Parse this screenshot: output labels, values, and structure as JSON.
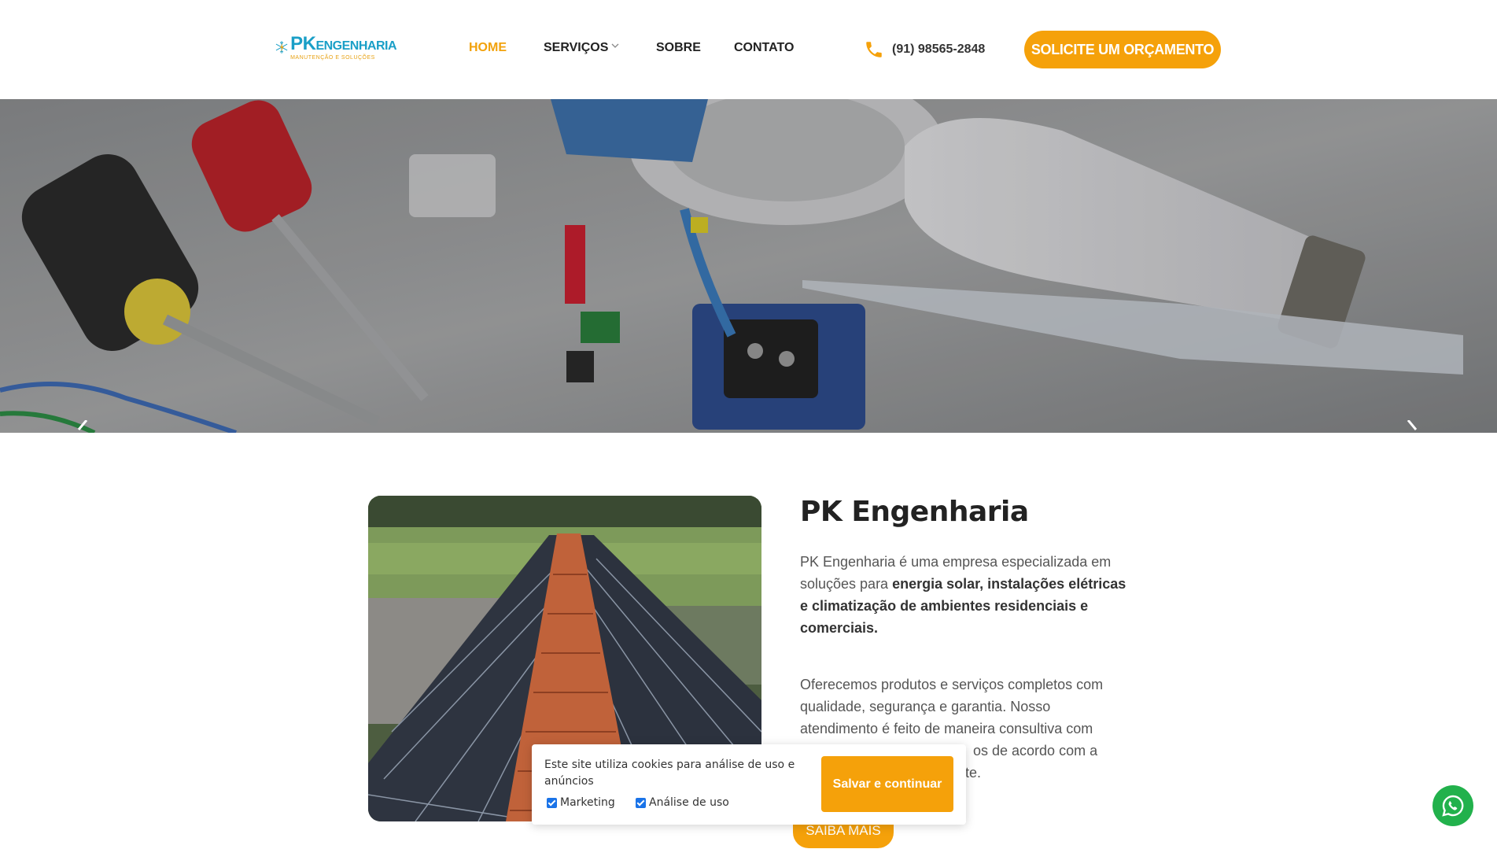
{
  "header": {
    "logo": {
      "title_big": "PK",
      "title_small": "ENGENHARIA",
      "subtitle": "MANUTENÇÃO E SOLUÇÕES"
    },
    "nav": [
      {
        "label": "HOME",
        "active": true
      },
      {
        "label": "SERVIÇOS",
        "has_dropdown": true
      },
      {
        "label": "SOBRE"
      },
      {
        "label": "CONTATO"
      }
    ],
    "phone": "(91) 98565-2848",
    "cta": "SOLICITE UM ORÇAMENTO"
  },
  "hero": {
    "prev_icon": "chevron-left-icon",
    "next_icon": "chevron-right-icon"
  },
  "about": {
    "title": "PK Engenharia",
    "p1_plain": "PK Engenharia é uma empresa especializada em soluções para ",
    "p1_bold": "energia solar, instalações elétricas e climatização de ambientes residenciais e comerciais.",
    "p2": "Oferecemos produtos e serviços completos com qualidade, segurança e garantia. Nosso atendimento é feito de maneira consultiva com",
    "p2_line5_visible": "os de acordo com a",
    "p2_line6_visible": "te.",
    "button": "SAIBA MAIS"
  },
  "cookie": {
    "text": "Este site utiliza cookies para análise de uso e anúncios",
    "options": [
      {
        "label": "Marketing",
        "checked": true
      },
      {
        "label": "Análise de uso",
        "checked": true
      }
    ],
    "button": "Salvar e continuar"
  },
  "colors": {
    "accent": "#f5a10a",
    "brand_blue": "#1a9fc7",
    "whatsapp": "#22b14c"
  }
}
